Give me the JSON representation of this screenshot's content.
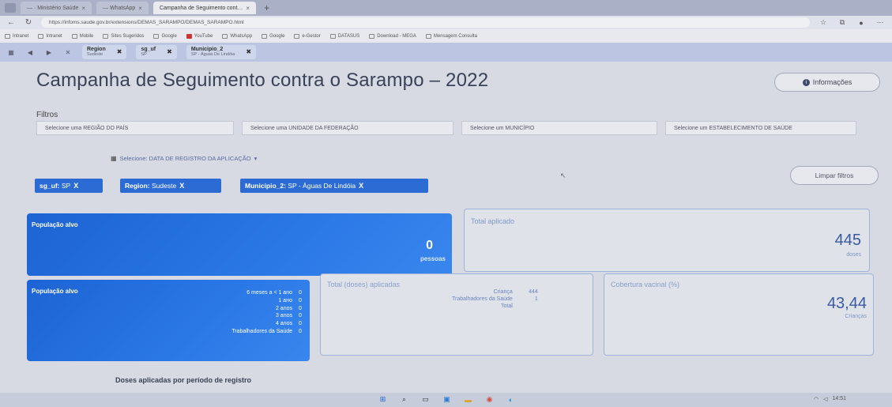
{
  "browser": {
    "tabs": [
      {
        "label": "— · Ministério Saúde",
        "active": false
      },
      {
        "label": "— WhatsApp",
        "active": false
      },
      {
        "label": "Campanha de Seguimento cont…",
        "active": true
      }
    ],
    "url": "https://infoms.saude.gov.br/extensions/DEMAS_SARAMPO/DEMAS_SARAMPO.html",
    "bookmarks": [
      "Intranet",
      "Intranet",
      "Mobile",
      "Sites Sugeridos",
      "Google",
      "YouTube",
      "WhatsApp",
      "Google",
      "e-Gestor",
      "DATASUS",
      "Download - MEGA",
      "Mensagem Consulta"
    ],
    "filter_strip": [
      {
        "label": "Region",
        "sub": "Sudeste"
      },
      {
        "label": "sg_uf",
        "sub": "SP"
      },
      {
        "label": "Municipio_2",
        "sub": "SP - Águas De Lindóia"
      }
    ]
  },
  "page": {
    "title": "Campanha de Seguimento contra o Sarampo – 2022",
    "info_button": "Informações",
    "filtros_label": "Filtros",
    "dropdowns": [
      "Selecione uma REGIÃO DO PAÍS",
      "Selecione uma UNIDADE DA FEDERAÇÃO",
      "Selecione um MUNICÍPIO",
      "Selecione um ESTABELECIMENTO DE SAÚDE"
    ],
    "date_filter": "Selecione: DATA DE REGISTRO DA APLICAÇÃO",
    "chips": [
      {
        "key": "sg_uf:",
        "value": " SP"
      },
      {
        "key": "Region:",
        "value": " Sudeste"
      },
      {
        "key": "Municipio_2:",
        "value": " SP - Águas De Lindóia"
      }
    ],
    "clear_button": "Limpar filtros",
    "cards": {
      "populacao_1": {
        "title": "População alvo",
        "value": "0",
        "unit": "pessoas"
      },
      "total_aplicado": {
        "title": "Total aplicado",
        "value": "445",
        "unit": "doses"
      },
      "populacao_2": {
        "title": "População alvo",
        "rows": [
          {
            "label": "6 meses a < 1 ano",
            "value": "0"
          },
          {
            "label": "1 ano",
            "value": "0"
          },
          {
            "label": "2 anos",
            "value": "0"
          },
          {
            "label": "3 anos",
            "value": "0"
          },
          {
            "label": "4 anos",
            "value": "0"
          },
          {
            "label": "Trabalhadores da Saúde",
            "value": "0"
          }
        ]
      },
      "total_doses": {
        "title": "Total (doses) aplicadas",
        "rows": [
          {
            "label": "Criança",
            "value": "444"
          },
          {
            "label": "Trabalhadores da Saúde",
            "value": "1"
          },
          {
            "label": "Total",
            "value": ""
          }
        ]
      },
      "cobertura": {
        "title": "Cobertura vacinal (%)",
        "value": "43,44",
        "unit": "Crianças"
      }
    },
    "section_title": "Doses aplicadas por período de registro"
  },
  "taskbar": {
    "clock": "14:51"
  }
}
